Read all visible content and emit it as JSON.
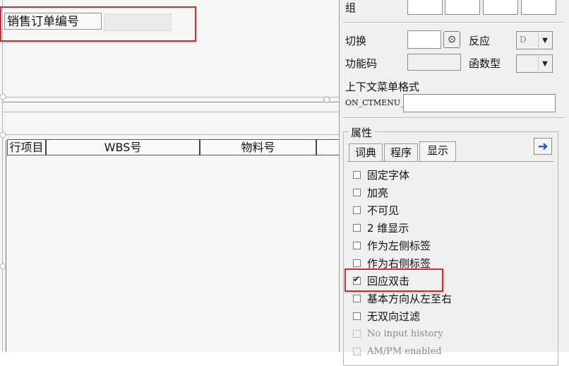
{
  "canvas": {
    "field_label": "销售订单编号",
    "grid_columns": [
      "行项目",
      "WBS号",
      "物料号"
    ]
  },
  "panel": {
    "group_label": "组",
    "toggle_label": "切换",
    "toggle_btn_glyph": "⊙",
    "response_label": "反应",
    "response_value": "D",
    "function_code_label": "功能码",
    "function_type_label": "函数型",
    "context_menu_label": "上下文菜单格式",
    "context_menu_prefix": "ON_CTMENU_",
    "properties_title": "属性",
    "tabs": [
      "词典",
      "程序",
      "显示"
    ],
    "active_tab": "显示",
    "checkboxes": [
      {
        "label": "固定字体",
        "checked": false,
        "enabled": true
      },
      {
        "label": "加亮",
        "checked": false,
        "enabled": true
      },
      {
        "label": "不可见",
        "checked": false,
        "enabled": true
      },
      {
        "label": "2 维显示",
        "checked": false,
        "enabled": true
      },
      {
        "label": "作为左侧标签",
        "checked": false,
        "enabled": true
      },
      {
        "label": "作为右侧标签",
        "checked": false,
        "enabled": true
      },
      {
        "label": "回应双击",
        "checked": true,
        "enabled": true
      },
      {
        "label": "基本方向从左至右",
        "checked": false,
        "enabled": true
      },
      {
        "label": "无双向过滤",
        "checked": false,
        "enabled": true
      },
      {
        "label": "No input history",
        "checked": false,
        "enabled": false
      },
      {
        "label": "AM/PM enabled",
        "checked": false,
        "enabled": false
      }
    ]
  },
  "colors": {
    "highlight": "#c0343a",
    "arrow": "#1a4fcf"
  },
  "icons": {
    "nav": "arrow-right-icon",
    "toggle": "target-icon",
    "check": "checkmark-icon"
  }
}
